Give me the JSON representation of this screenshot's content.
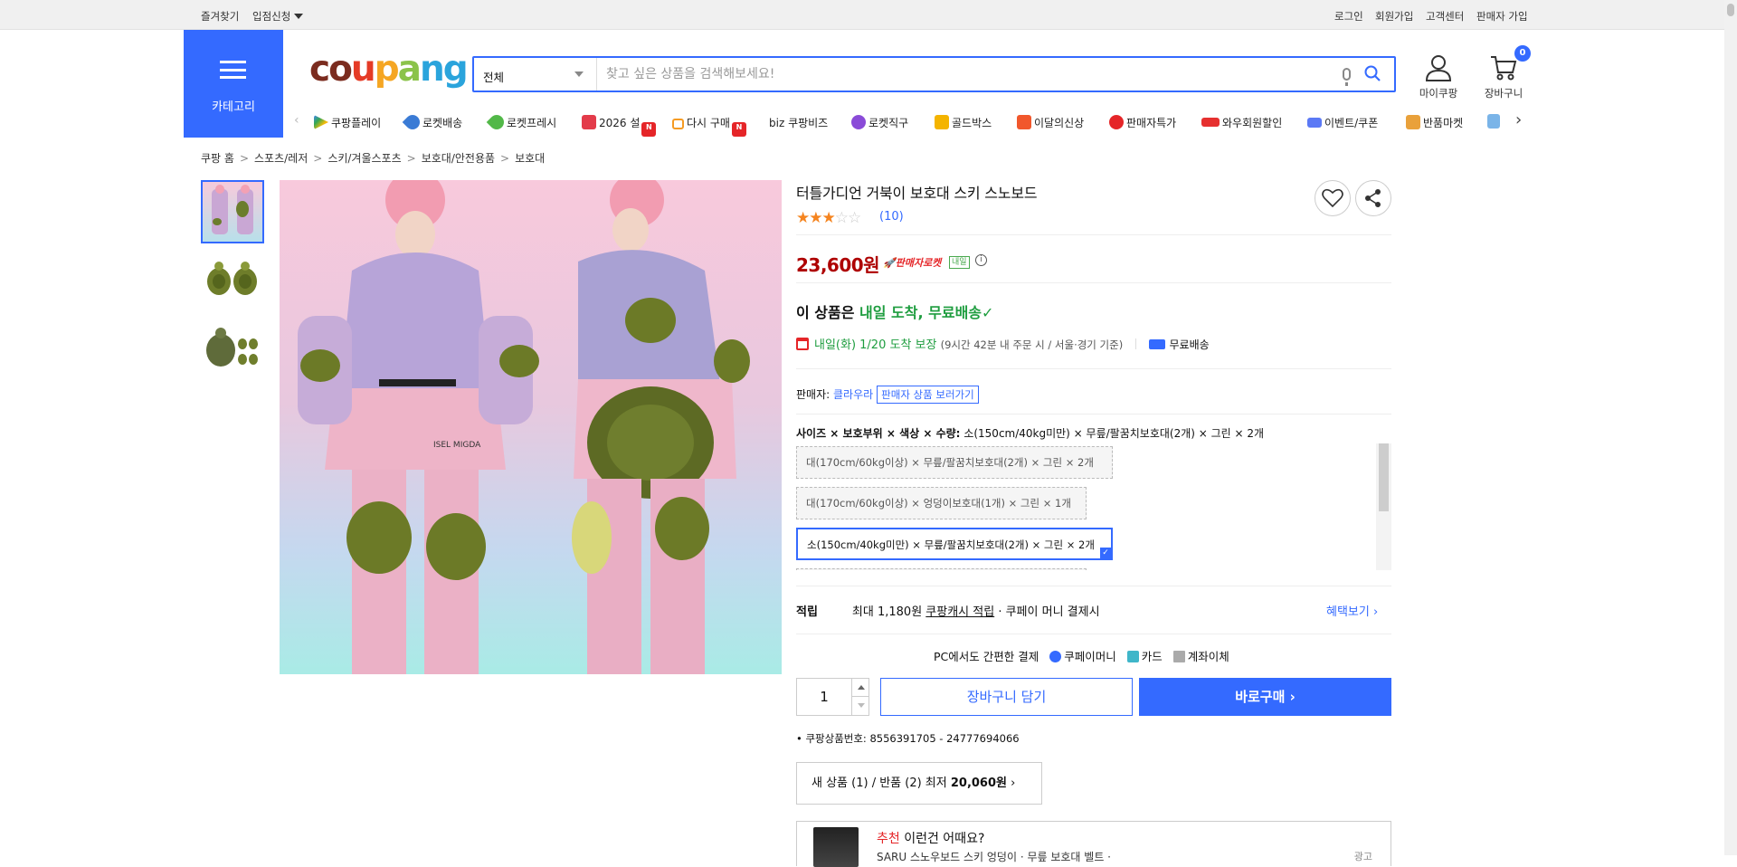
{
  "topbar": {
    "left": [
      "즐겨찾기",
      "입점신청"
    ],
    "right": [
      "로그인",
      "회원가입",
      "고객센터",
      "판매자 가입"
    ]
  },
  "header": {
    "category_label": "카테고리",
    "logo_text": "coupang",
    "search_select": "전체",
    "search_placeholder": "찾고 싶은 상품을 검색해보세요!",
    "mypage_label": "마이쿠팡",
    "cart_label": "장바구니",
    "cart_count": "0"
  },
  "nav": {
    "items": [
      "쿠팡플레이",
      "로켓배송",
      "로켓프레시",
      "2026 설",
      "다시 구매",
      "biz 쿠팡비즈",
      "로켓직구",
      "골드박스",
      "이달의신상",
      "판매자특가",
      "와우회원할인",
      "이벤트/쿠폰",
      "반품마켓"
    ],
    "new_badge": "N"
  },
  "breadcrumb": [
    "쿠팡 홈",
    "스포츠/레저",
    "스키/겨울스포츠",
    "보호대/안전용품",
    "보호대"
  ],
  "image_text": {
    "jacket_print": "ISEL MIGDA"
  },
  "product": {
    "title": "터틀가디언 거북이 보호대 스키 스노보드",
    "rating": 3,
    "review_count": "(10)",
    "price": "23,600원",
    "rocket_label": "판매자로켓",
    "naeil_badge": "내일",
    "info_icon": "i",
    "delivery_prefix": "이 상품은 ",
    "delivery_highlight": "내일 도착, 무료배송",
    "delivery_check": "✓",
    "delivery_date": "내일(화) 1/20 도착 보장",
    "delivery_cond": "(9시간 42분 내 주문 시 / 서울·경기 기준)",
    "free_shipping": "무료배송",
    "seller_prefix": "판매자: ",
    "seller_name": "클라우라",
    "seller_btn": "판매자 상품 보러가기",
    "option_label_bold": "사이즈 × 보호부위 × 색상 × 수량:",
    "option_label_value": "소(150cm/40kg미만) × 무릎/팔꿈치보호대(2개) × 그린 × 2개",
    "options": [
      "대(170cm/60kg이상) × 무릎/팔꿈치보호대(2개) × 그린 × 2개",
      "대(170cm/60kg이상) × 엉덩이보호대(1개) × 그린 × 1개",
      "소(150cm/40kg미만) × 무릎/팔꿈치보호대(2개) × 그린 × 2개"
    ],
    "selected_option_index": 2,
    "points_label": "적립",
    "points_text": "최대 1,180원",
    "points_link": "쿠팡캐시 적립",
    "points_suffix": " · 쿠페이 머니 결제시",
    "benefit_link": "혜택보기",
    "pcpay_label": "PC에서도 간편한 결제",
    "pay_methods": [
      "쿠페이머니",
      "카드",
      "계좌이체"
    ],
    "quantity": "1",
    "cart_btn": "장바구니 담기",
    "buy_btn": "바로구매",
    "product_no_label": "쿠팡상품번호: ",
    "product_no": "8556391705 - 24777694066",
    "new_used_text": "새 상품 (1) / 반품 (2) 최저 ",
    "new_used_price": "20,060원",
    "reco_highlight": "추천",
    "reco_title": " 이런건 어때요?",
    "reco_sub": "SARU 스노우보드 스키 엉덩이 · 무릎 보호대 벨트 · ",
    "reco_ad": "광고"
  },
  "colors": {
    "brand_blue": "#346aff",
    "price_red": "#ae0000",
    "delivery_green": "#1e9d3f",
    "star": "#f5841f"
  }
}
